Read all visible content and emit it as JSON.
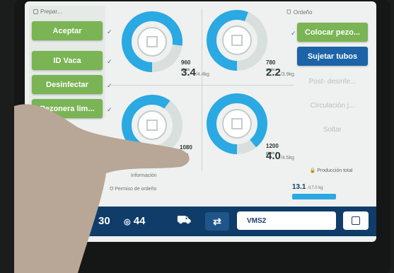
{
  "left_panel": {
    "title": "Prepar...",
    "buttons": [
      "Aceptar",
      "ID Vaca",
      "Desinfectar",
      "Pezonera lim..."
    ]
  },
  "quarters": [
    {
      "rate": "960",
      "rate_unit": "g/min",
      "yield": "3.4",
      "expected": "/4.4kg",
      "fill": 0.77
    },
    {
      "rate": "780",
      "rate_unit": "g/min",
      "yield": "2.2",
      "expected": "/3.9kg",
      "fill": 0.56
    },
    {
      "rate": "1080",
      "rate_unit": "g/min",
      "yield": "",
      "expected": "",
      "fill": 0.6
    },
    {
      "rate": "1200",
      "rate_unit": "g/min",
      "yield": "4.0",
      "expected": "/4.5kg",
      "fill": 0.89
    }
  ],
  "info": {
    "information_label": "Información",
    "permission_label": "Permiso de ordeño"
  },
  "right_panel": {
    "title": "Ordeño",
    "buttons": [
      {
        "label": "Colocar pezo...",
        "style": "green"
      },
      {
        "label": "Sujetar tubos",
        "style": "blue"
      },
      {
        "label": "Post- desinfe...",
        "style": "disabled"
      },
      {
        "label": "Circulación j...",
        "style": "disabled"
      },
      {
        "label": "Soltar",
        "style": "disabled"
      }
    ]
  },
  "production": {
    "label": "Producción total",
    "value": "13.1",
    "expected": "/17.0 kg",
    "fill": 0.77
  },
  "bottom_bar": {
    "counter_a": "30",
    "counter_b": "44",
    "station": "VMS2"
  },
  "colors": {
    "green": "#7ab455",
    "blue": "#1c63a8",
    "cyan": "#2aa9e3",
    "navy": "#0f3c69"
  }
}
